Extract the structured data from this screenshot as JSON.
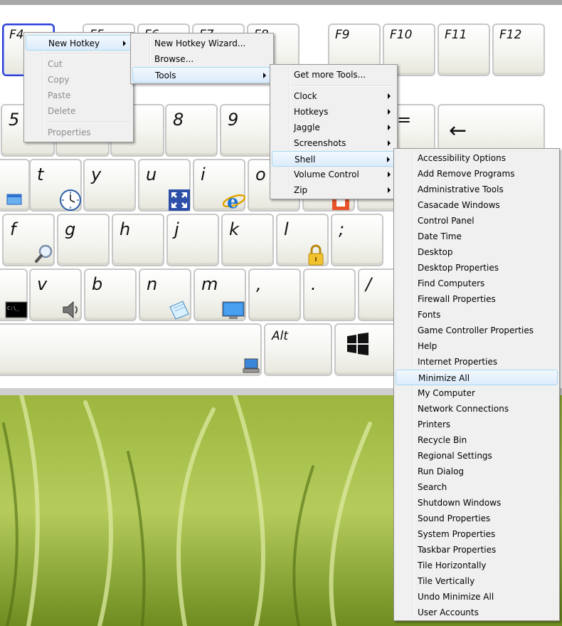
{
  "keyboard": {
    "fkeys": [
      "F4",
      "F5",
      "F6",
      "F7",
      "F8",
      "F9",
      "F10",
      "F11",
      "F12"
    ],
    "row1": [
      "5",
      "8",
      "9",
      "=",
      "←"
    ],
    "row2": [
      "t",
      "y",
      "u",
      "i",
      "o"
    ],
    "row3": [
      "f",
      "g",
      "h",
      "j",
      "k",
      "l",
      ";"
    ],
    "row4": [
      "v",
      "b",
      "n",
      "m",
      ",",
      ".",
      "/"
    ],
    "row5_alt": "Alt"
  },
  "menus": {
    "context": {
      "items": [
        "New Hotkey",
        "Cut",
        "Copy",
        "Paste",
        "Delete",
        "Properties"
      ],
      "highlighted": "New Hotkey"
    },
    "new_hotkey": {
      "items": [
        "New Hotkey Wizard...",
        "Browse...",
        "Tools"
      ],
      "highlighted": "Tools"
    },
    "tools": {
      "items": [
        "Get more Tools...",
        "Clock",
        "Hotkeys",
        "Jaggle",
        "Screenshots",
        "Shell",
        "Volume Control",
        "Zip"
      ],
      "highlighted": "Shell"
    },
    "shell": {
      "items": [
        "Accessibility Options",
        "Add Remove Programs",
        "Administrative Tools",
        "Casacade Windows",
        "Control Panel",
        "Date Time",
        "Desktop",
        "Desktop Properties",
        "Find Computers",
        "Firewall Properties",
        "Fonts",
        "Game Controller Properties",
        "Help",
        "Internet Properties",
        "Minimize All",
        "My Computer",
        "Network Connections",
        "Printers",
        "Recycle Bin",
        "Regional Settings",
        "Run Dialog",
        "Search",
        "Shutdown Windows",
        "Sound Properties",
        "System Properties",
        "Taskbar Properties",
        "Tile Horizontally",
        "Tile Vertically",
        "Undo Minimize All",
        "User Accounts"
      ],
      "highlighted": "Minimize All"
    }
  },
  "icons": {
    "clock_key": "clock-icon",
    "fullscreen_key": "fullscreen-icon",
    "ie_key": "internet-explorer-icon",
    "search_key": "magnifier-icon",
    "lock_key": "padlock-icon",
    "cmd_key": "command-prompt-icon",
    "speaker_key": "speaker-icon",
    "notepad_key": "notepad-icon",
    "desktop_key": "desktop-icon",
    "network_key": "network-computer-icon",
    "windows_key": "windows-logo-icon"
  },
  "colors": {
    "selected_key_border": "#2a3fd0",
    "menu_bg": "#f0f0f0",
    "menu_highlight": "#dcebfb",
    "menu_highlight_border": "#a8d8f4",
    "disabled_text": "#8d8d8d"
  }
}
